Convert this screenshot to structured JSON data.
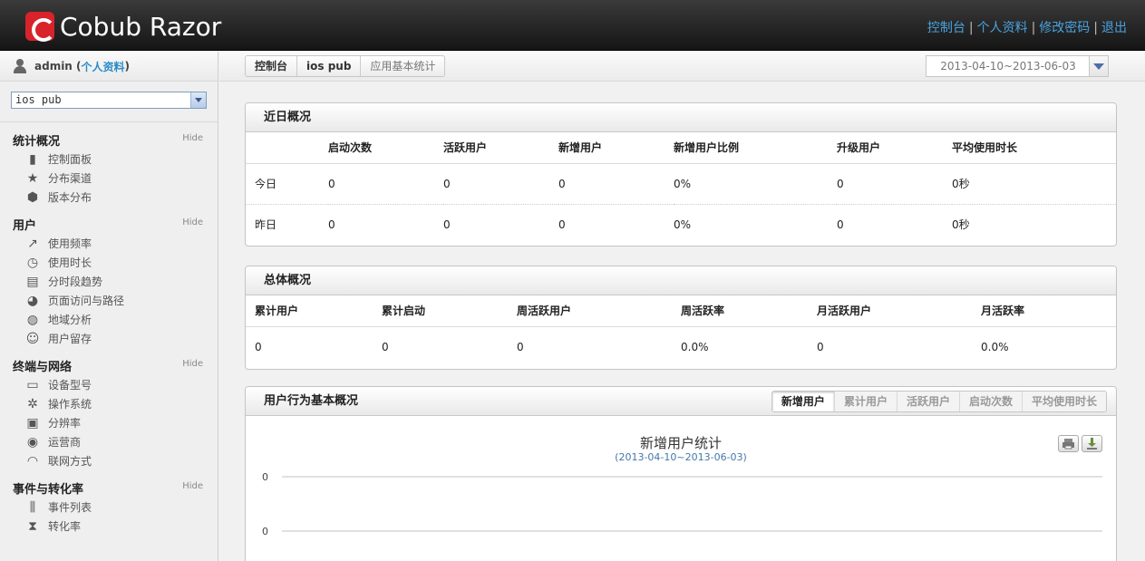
{
  "header": {
    "brand": "Cobub Razor",
    "links": [
      "控制台",
      "个人资料",
      "修改密码",
      "退出"
    ]
  },
  "sidebar": {
    "user": "admin",
    "profile_link": "个人资料",
    "app_select": "ios pub",
    "hide_label": "Hide",
    "sections": [
      {
        "title": "统计概况",
        "items": [
          {
            "label": "控制面板",
            "icon": "bar-chart-icon"
          },
          {
            "label": "分布渠道",
            "icon": "star-icon"
          },
          {
            "label": "版本分布",
            "icon": "cube-icon"
          }
        ]
      },
      {
        "title": "用户",
        "items": [
          {
            "label": "使用频率",
            "icon": "trend-icon"
          },
          {
            "label": "使用时长",
            "icon": "clock-icon"
          },
          {
            "label": "分时段趋势",
            "icon": "area-chart-icon"
          },
          {
            "label": "页面访问与路径",
            "icon": "pie-icon"
          },
          {
            "label": "地域分析",
            "icon": "globe-icon"
          },
          {
            "label": "用户留存",
            "icon": "user-add-icon"
          }
        ]
      },
      {
        "title": "终端与网络",
        "items": [
          {
            "label": "设备型号",
            "icon": "laptop-icon"
          },
          {
            "label": "操作系统",
            "icon": "gear-icon"
          },
          {
            "label": "分辨率",
            "icon": "tv-icon"
          },
          {
            "label": "运营商",
            "icon": "users-icon"
          },
          {
            "label": "联网方式",
            "icon": "wifi-icon"
          }
        ]
      },
      {
        "title": "事件与转化率",
        "items": [
          {
            "label": "事件列表",
            "icon": "sliders-icon"
          },
          {
            "label": "转化率",
            "icon": "hourglass-icon"
          }
        ]
      }
    ]
  },
  "breadcrumb": [
    "控制台",
    "ios pub",
    "应用基本统计"
  ],
  "date_range": "2013-04-10~2013-06-03",
  "recent": {
    "title": "近日概况",
    "columns": [
      "",
      "启动次数",
      "活跃用户",
      "新增用户",
      "新增用户比例",
      "升级用户",
      "平均使用时长"
    ],
    "rows": [
      [
        "今日",
        "0",
        "0",
        "0",
        "0%",
        "0",
        "0秒"
      ],
      [
        "昨日",
        "0",
        "0",
        "0",
        "0%",
        "0",
        "0秒"
      ]
    ]
  },
  "overall": {
    "title": "总体概况",
    "columns": [
      "累计用户",
      "累计启动",
      "周活跃用户",
      "周活跃率",
      "月活跃用户",
      "月活跃率"
    ],
    "row": [
      "0",
      "0",
      "0",
      "0.0%",
      "0",
      "0.0%"
    ]
  },
  "behavior": {
    "title": "用户行为基本概况",
    "tabs": [
      "新增用户",
      "累计用户",
      "活跃用户",
      "启动次数",
      "平均使用时长"
    ],
    "active_tab": 0
  },
  "chart_data": {
    "type": "line",
    "title": "新增用户统计",
    "subtitle": "(2013-04-10~2013-06-03)",
    "y_ticks": [
      "0",
      "0"
    ],
    "series": []
  }
}
